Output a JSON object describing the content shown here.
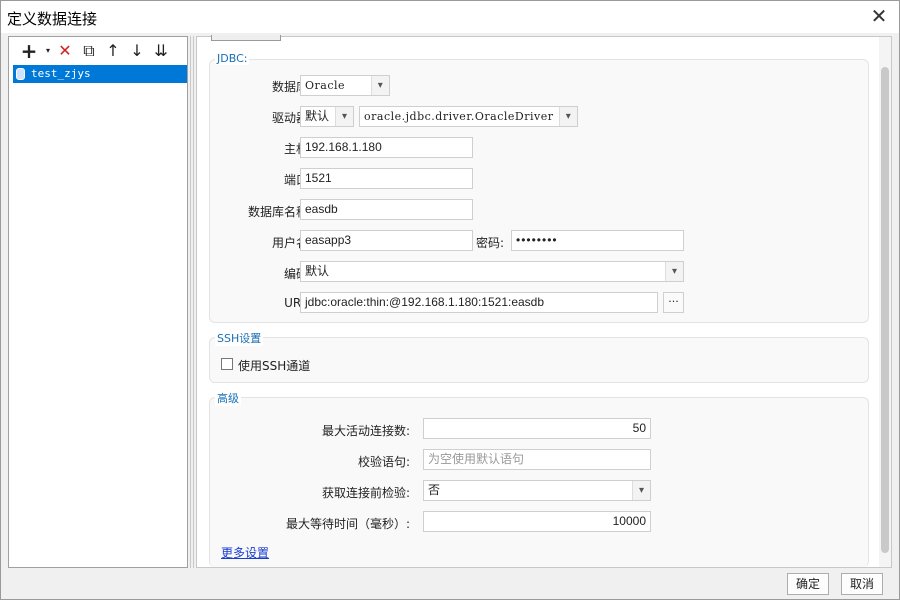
{
  "window": {
    "title": "定义数据连接"
  },
  "tree": {
    "items": [
      "test_zjys"
    ]
  },
  "jdbc": {
    "section_title": "JDBC:",
    "database_label": "数据库:",
    "database_value": "Oracle",
    "driver_label": "驱动器:",
    "driver_mode": "默认",
    "driver_class": "oracle.jdbc.driver.OracleDriver",
    "host_label": "主机:",
    "host_value": "192.168.1.180",
    "port_label": "端口:",
    "port_value": "1521",
    "dbname_label": "数据库名称:",
    "dbname_value": "easdb",
    "username_label": "用户名:",
    "username_value": "easapp3",
    "password_label": "密码:",
    "password_value": "••••••••",
    "encoding_label": "编码:",
    "encoding_value": "默认",
    "url_label": "URL:",
    "url_value": "jdbc:oracle:thin:@192.168.1.180:1521:easdb",
    "url_button": "···"
  },
  "ssh": {
    "section_title": "SSH设置",
    "use_ssh_label": "使用SSH通道"
  },
  "advanced": {
    "section_title": "高级",
    "max_active_label": "最大活动连接数:",
    "max_active_value": "50",
    "validation_label": "校验语句:",
    "validation_placeholder": "为空使用默认语句",
    "test_before_label": "获取连接前检验:",
    "test_before_value": "否",
    "max_wait_label": "最大等待时间（毫秒）:",
    "max_wait_value": "10000",
    "more_settings": "更多设置"
  },
  "footer": {
    "ok": "确定",
    "cancel": "取消"
  },
  "icons": [
    "add-icon",
    "delete-icon",
    "copy-icon",
    "move-up-icon",
    "move-down-icon",
    "sort-icon",
    "database-icon",
    "close-icon"
  ]
}
